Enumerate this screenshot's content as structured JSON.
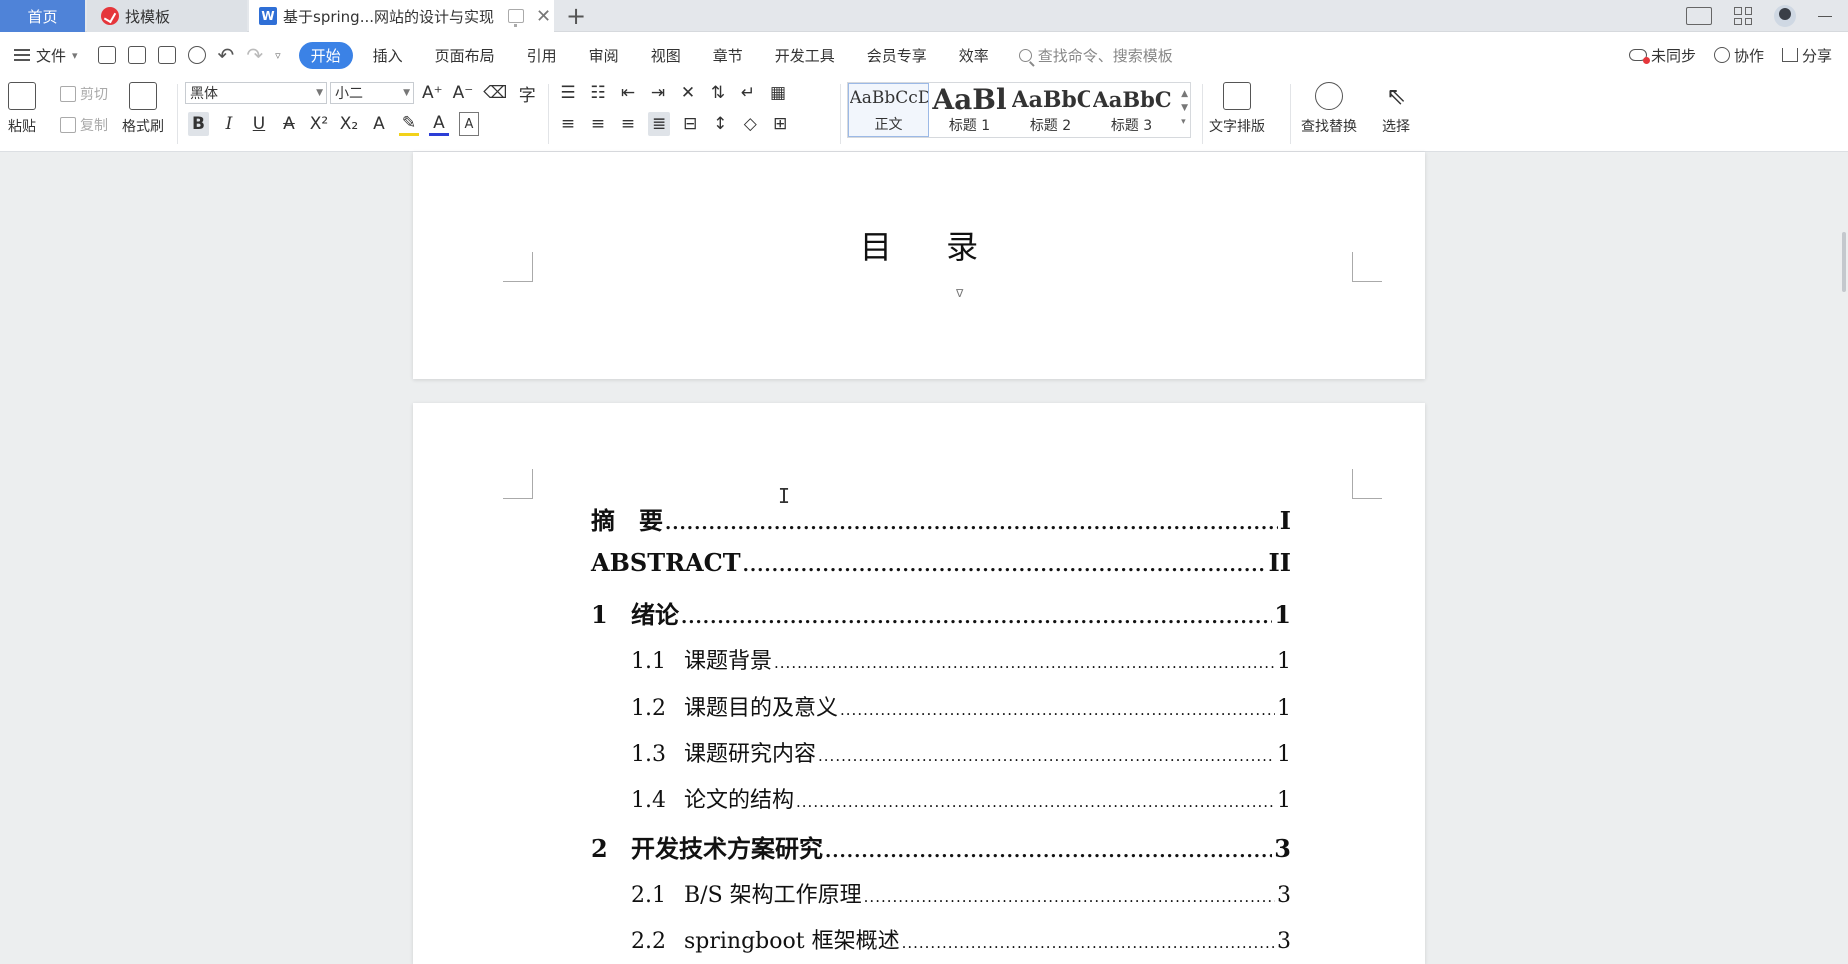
{
  "tabs": {
    "home": "首页",
    "templates": "找模板",
    "document": "基于spring...网站的设计与实现"
  },
  "menubar": {
    "file": "文件",
    "items": [
      "开始",
      "插入",
      "页面布局",
      "引用",
      "审阅",
      "视图",
      "章节",
      "开发工具",
      "会员专享",
      "效率"
    ],
    "active_index": 0,
    "search_placeholder": "查找命令、搜索模板",
    "sync": "未同步",
    "collab": "协作",
    "share": "分享"
  },
  "ribbon": {
    "paste": "粘贴",
    "cut": "剪切",
    "copy": "复制",
    "format_painter": "格式刷",
    "font_name": "黑体",
    "font_size": "小二",
    "styles": [
      {
        "sample": "AaBbCcD",
        "name": "正文"
      },
      {
        "sample": "AaBl",
        "name": "标题 1"
      },
      {
        "sample": "AaBbC",
        "name": "标题 2"
      },
      {
        "sample": "AaBbC",
        "name": "标题 3"
      }
    ],
    "text_layout": "文字排版",
    "find_replace": "查找替换",
    "select": "选择"
  },
  "document": {
    "toc_title": "目 录",
    "entries": [
      {
        "level": 1,
        "num": "",
        "title": "摘　要",
        "page": "I"
      },
      {
        "level": 1,
        "num": "",
        "title": "ABSTRACT",
        "page": "II"
      },
      {
        "level": 1,
        "num": "1",
        "title": "绪论",
        "page": "1"
      },
      {
        "level": 2,
        "num": "1.1",
        "title": "课题背景",
        "page": "1"
      },
      {
        "level": 2,
        "num": "1.2",
        "title": "课题目的及意义",
        "page": "1"
      },
      {
        "level": 2,
        "num": "1.3",
        "title": "课题研究内容",
        "page": "1"
      },
      {
        "level": 2,
        "num": "1.4",
        "title": "论文的结构",
        "page": "1"
      },
      {
        "level": 1,
        "num": "2",
        "title": "开发技术方案研究",
        "page": "3"
      },
      {
        "level": 2,
        "num": "2.1",
        "title": "B/S 架构工作原理",
        "page": "3"
      },
      {
        "level": 2,
        "num": "2.2",
        "title": "springboot 框架概述",
        "page": "3"
      }
    ]
  },
  "colors": {
    "accent": "#3b82e6",
    "home_tab": "#4f83d8"
  }
}
